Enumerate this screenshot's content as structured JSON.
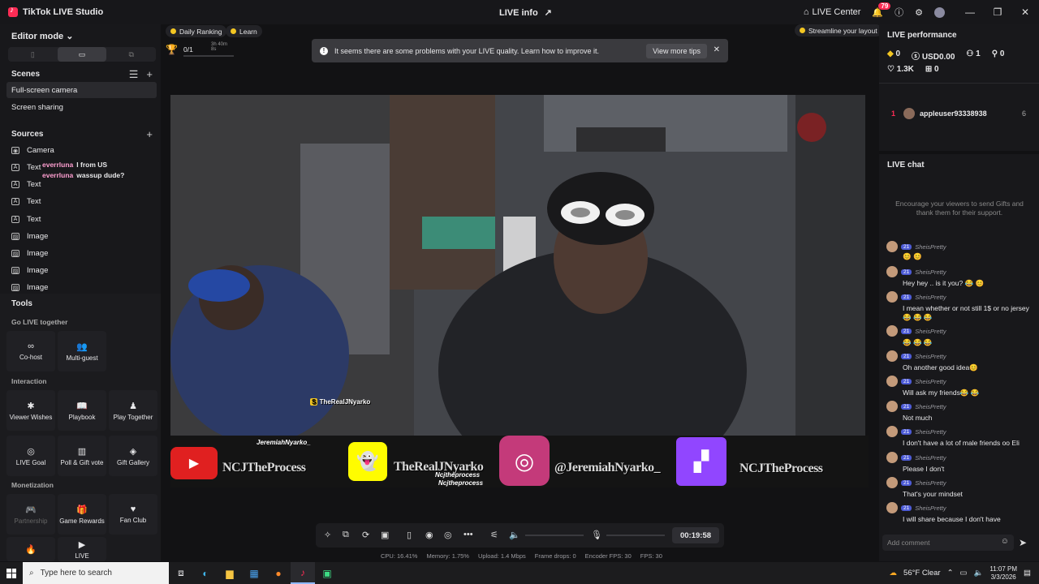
{
  "app": {
    "title": "TikTok LIVE Studio",
    "center_title": "LIVE info",
    "live_center": "LIVE Center",
    "notif_count": "79"
  },
  "left": {
    "editor_mode": "Editor mode",
    "scenes_label": "Scenes",
    "scenes": [
      "Full-screen camera",
      "Screen sharing"
    ],
    "sources_label": "Sources",
    "sources": [
      {
        "type": "Camera",
        "icon": "camera-icon"
      },
      {
        "type": "Text",
        "icon": "text-icon"
      },
      {
        "type": "Text",
        "icon": "text-icon"
      },
      {
        "type": "Text",
        "icon": "text-icon"
      },
      {
        "type": "Text",
        "icon": "text-icon"
      },
      {
        "type": "Image",
        "icon": "image-icon"
      },
      {
        "type": "Image",
        "icon": "image-icon"
      },
      {
        "type": "Image",
        "icon": "image-icon"
      },
      {
        "type": "Image",
        "icon": "image-icon"
      }
    ],
    "overlay_chat": [
      {
        "user": "everrluna",
        "text": "I from US"
      },
      {
        "user": "everrluna",
        "text": "wassup dude?"
      }
    ],
    "tools_label": "Tools",
    "go_live_together": "Go LIVE together",
    "interaction": "Interaction",
    "monetization": "Monetization",
    "tools": {
      "cohost": "Co-host",
      "multiguest": "Multi-guest",
      "viewer_wishes": "Viewer Wishes",
      "playbook": "Playbook",
      "play_together": "Play Together",
      "live_goal": "LIVE Goal",
      "poll_gift": "Poll & Gift vote",
      "gift_gallery": "Gift Gallery",
      "partnership": "Partnership",
      "game_rewards": "Game Rewards",
      "fan_club": "Fan Club",
      "more": "LIVE"
    }
  },
  "top": {
    "daily_ranking": "Daily Ranking",
    "learn": "Learn",
    "progress": "0/1",
    "progress_time": "3h 40m 8s",
    "streamline": "Streamline your layout"
  },
  "warning": {
    "text": "It seems there are some problems with your LIVE quality. Learn how to improve it.",
    "button": "View more tips"
  },
  "stream": {
    "name_tag": "TheRealJNyarko",
    "socials": {
      "youtube": "NCJTheProcess",
      "snap_tag": "JeremiahNyarko_",
      "snapchat": "TheRealJNyarko",
      "insta_tag1": "Ncjtheprocess",
      "insta_tag2": "Ncjtheprocess",
      "instagram": "@JeremiahNyarko_",
      "twitch": "NCJTheProcess"
    }
  },
  "controls": {
    "timer": "00:19:58",
    "volume_fraction": 0.0,
    "mic_fraction": 0.0
  },
  "stats": {
    "cpu": "CPU: 16.41%",
    "memory": "Memory: 1.75%",
    "upload": "Upload: 1.4 Mbps",
    "frame_drops": "Frame drops: 0",
    "encoder_fps": "Encoder FPS: 30",
    "fps": "FPS: 30"
  },
  "right": {
    "perf_title": "LIVE performance",
    "coins": "0",
    "usd": "USD0.00",
    "viewers": "1",
    "new_followers": "0",
    "likes": "1.3K",
    "gifts": "0",
    "ranking": {
      "rank": "1",
      "user": "appleuser93338938",
      "score": "6"
    },
    "chat_title": "LIVE chat",
    "chat_hint": "Encourage your viewers to send Gifts and thank them for their support.",
    "chat_level": "21",
    "chat_user": "SheisPretty",
    "messages": [
      "😊 😊",
      "Hey hey .. is it you? 😂 😊",
      "I mean whether or not still 1$ or no jersey 😂 😂 😂",
      "😂 😂 😂",
      "Oh another good idea😊",
      "Will ask my friends😂 😂",
      "Not much",
      "I don't have a lot of male friends oo Eli",
      "Please I don't",
      "That's your mindset",
      "I will share because I don't have"
    ],
    "comment_placeholder": "Add comment"
  },
  "taskbar": {
    "search_placeholder": "Type here to search",
    "weather": "56°F  Clear",
    "time": "11:07 PM",
    "date": "3/3/2026"
  }
}
